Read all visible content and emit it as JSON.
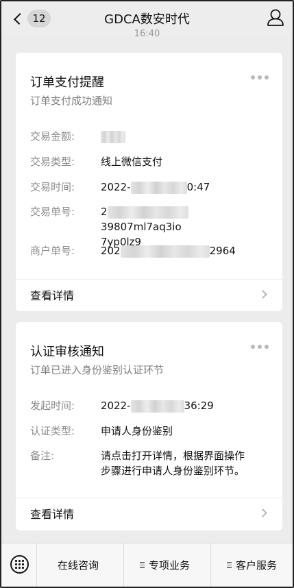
{
  "header": {
    "badge_count": "12",
    "title": "GDCA数安时代",
    "timestamp": "16:40"
  },
  "card1": {
    "title": "订单支付提醒",
    "subtitle": "订单支付成功通知",
    "fields": [
      {
        "label": "交易金额:",
        "value": ""
      },
      {
        "label": "交易类型:",
        "value": "线上微信支付"
      },
      {
        "label": "交易时间:",
        "value_prefix": "2022-",
        "value_suffix": "0:47"
      },
      {
        "label": "交易单号:",
        "value_prefix": "2",
        "value_suffix": "39807ml7aq3io",
        "value_line2": "7yp0lz9"
      },
      {
        "label": "商户单号:",
        "value_prefix": "202",
        "value_suffix": "2964"
      }
    ],
    "detail_label": "查看详情"
  },
  "card2": {
    "title": "认证审核通知",
    "subtitle": "订单已进入身份鉴别认证环节",
    "fields": [
      {
        "label": "发起时间:",
        "value_prefix": "2022-",
        "value_suffix": "36:29"
      },
      {
        "label": "认证类型:",
        "value": "申请人身份鉴别"
      },
      {
        "label": "备注:",
        "value": "请点击打开详情，根据界面操作",
        "value_line2": "步骤进行申请人身份鉴别环节。"
      }
    ],
    "detail_label": "查看详情"
  },
  "bottom": {
    "tab1": "在线咨询",
    "tab2": "专项业务",
    "tab3": "客户服务"
  }
}
